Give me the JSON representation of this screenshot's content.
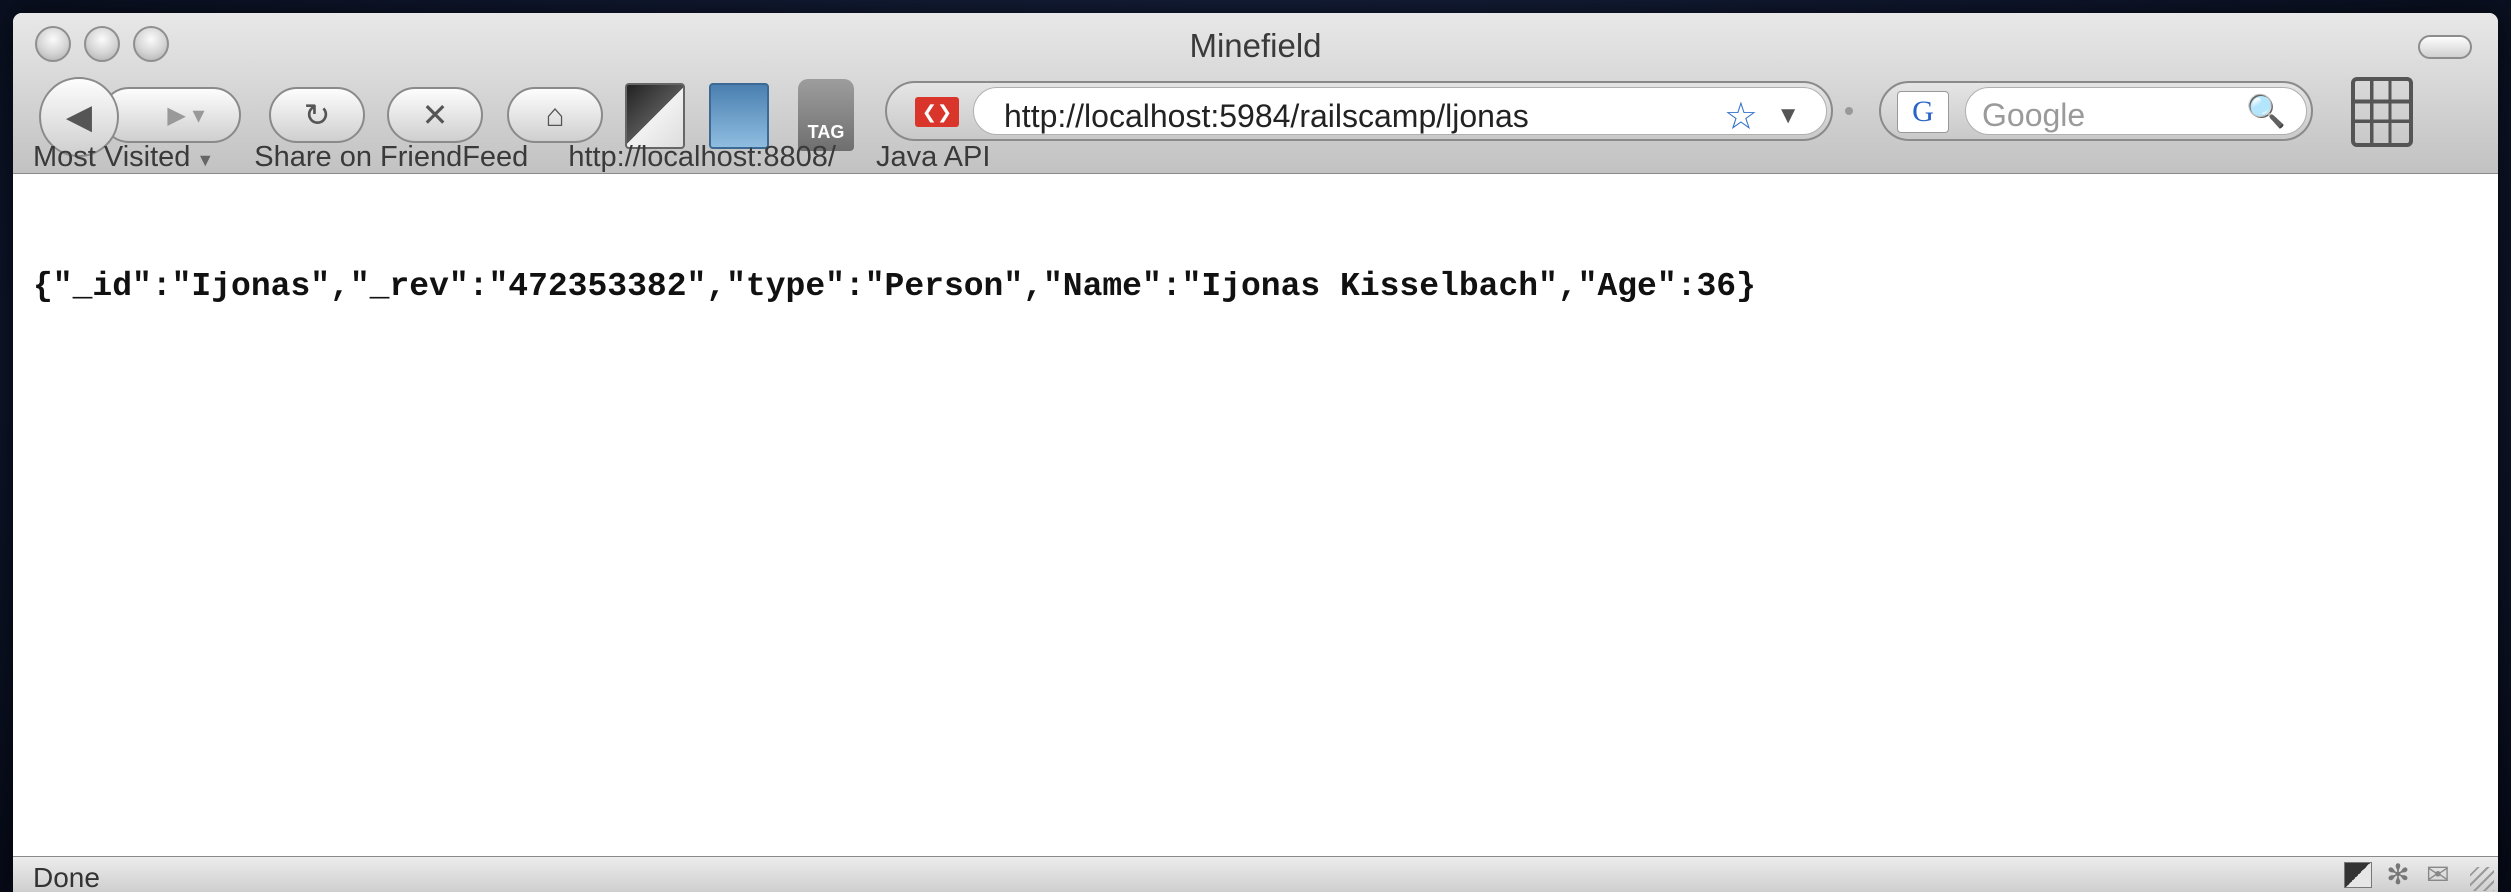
{
  "window": {
    "title": "Minefield"
  },
  "toolbar": {
    "back_icon": "◀",
    "forward_icon": "▶ ▾",
    "reload_icon": "↻",
    "stop_icon": "✕",
    "home_icon": "⌂",
    "tag_label": "TAG",
    "url": "http://localhost:5984/railscamp/ljonas",
    "site_icon": "❮❯",
    "star_icon": "☆",
    "dropdown_icon": "▼",
    "search_engine_label": "G",
    "search_placeholder": "Google",
    "search_icon": "🔍"
  },
  "bookmarks": {
    "items": [
      {
        "label": "Most Visited",
        "has_menu": true
      },
      {
        "label": "Share on FriendFeed"
      },
      {
        "label": "http://localhost:8808/"
      },
      {
        "label": "Java API"
      }
    ],
    "menu_arrow": "▼"
  },
  "content": {
    "json_text": "{\"_id\":\"Ijonas\",\"_rev\":\"472353382\",\"type\":\"Person\",\"Name\":\"Ijonas Kisselbach\",\"Age\":36}"
  },
  "status": {
    "text": "Done",
    "icons": [
      "tile-icon",
      "gear-icon",
      "mail-icon"
    ]
  }
}
